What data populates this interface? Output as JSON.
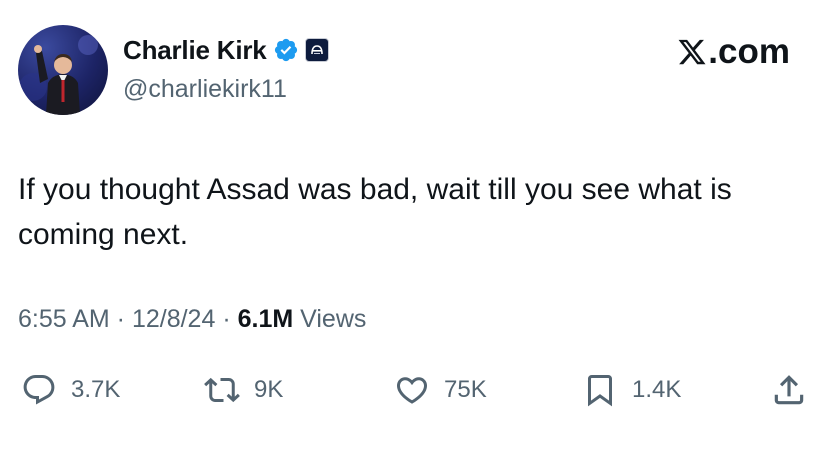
{
  "author": {
    "display_name": "Charlie Kirk",
    "handle": "@charliekirk11",
    "verified_color": "#1d9bf0"
  },
  "brand": {
    "label": ".com",
    "icon": "x-logo-icon"
  },
  "tweet": {
    "text": "If you thought Assad was bad, wait till you see what is coming next."
  },
  "meta": {
    "time": "6:55 AM",
    "sep1": " · ",
    "date": "12/8/24",
    "sep2": " · ",
    "views_count": "6.1M",
    "views_label": " Views"
  },
  "actions": {
    "replies": "3.7K",
    "reposts": "9K",
    "likes": "75K",
    "bookmarks": "1.4K"
  },
  "colors": {
    "text": "#0f1419",
    "secondary": "#536471",
    "accent": "#1d9bf0"
  }
}
